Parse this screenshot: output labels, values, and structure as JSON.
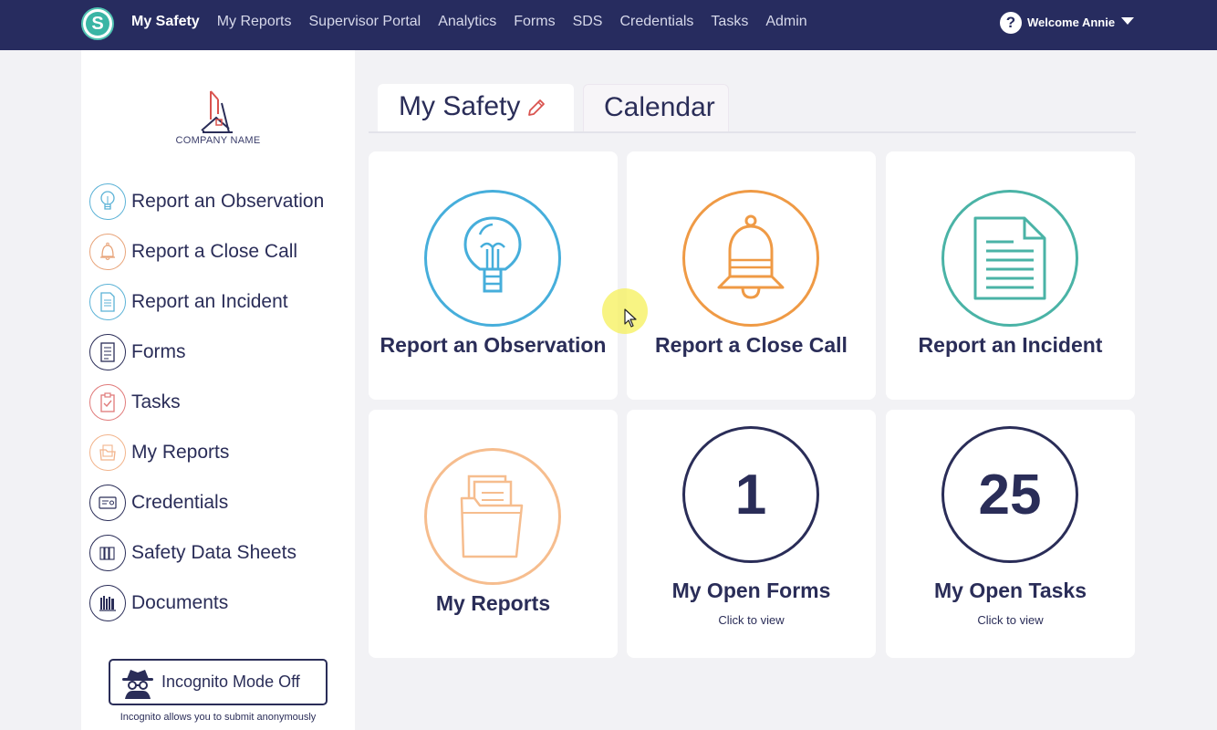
{
  "navbar": {
    "logo_letter": "S",
    "links": [
      {
        "label": "My Safety",
        "active": true
      },
      {
        "label": "My Reports"
      },
      {
        "label": "Supervisor Portal"
      },
      {
        "label": "Analytics"
      },
      {
        "label": "Forms"
      },
      {
        "label": "SDS"
      },
      {
        "label": "Credentials"
      },
      {
        "label": "Tasks"
      },
      {
        "label": "Admin"
      }
    ],
    "help_icon": "question-circle-icon",
    "welcome": "Welcome Annie",
    "colors": {
      "background": "#272c5f",
      "logo_teal": "#3ab5a5"
    }
  },
  "sidebar": {
    "company_name": "COMPANY NAME",
    "items": [
      {
        "label": "Report an Observation",
        "icon": "lightbulb-icon",
        "color": "#5bb2d6"
      },
      {
        "label": "Report a Close Call",
        "icon": "bell-icon",
        "color": "#e8a47a"
      },
      {
        "label": "Report an Incident",
        "icon": "document-icon",
        "color": "#5bb2d6"
      },
      {
        "label": "Forms",
        "icon": "form-icon",
        "color": "#2a2d58"
      },
      {
        "label": "Tasks",
        "icon": "clipboard-check-icon",
        "color": "#e07a7a"
      },
      {
        "label": "My Reports",
        "icon": "folder-icon",
        "color": "#f2b48c"
      },
      {
        "label": "Credentials",
        "icon": "id-card-icon",
        "color": "#2a2d58"
      },
      {
        "label": "Safety Data Sheets",
        "icon": "binders-icon",
        "color": "#2a2d58"
      },
      {
        "label": "Documents",
        "icon": "library-icon",
        "color": "#2a2d58"
      }
    ],
    "incognito": {
      "label": "Incognito Mode Off",
      "note": "Incognito allows you to submit anonymously",
      "icon": "spy-icon"
    }
  },
  "tabs": [
    {
      "label": "My Safety",
      "active": true,
      "edit_icon": "pencil-icon"
    },
    {
      "label": "Calendar",
      "active": false
    }
  ],
  "cards": [
    {
      "title": "Report an Observation",
      "icon": "lightbulb-icon",
      "color": "#46aedb"
    },
    {
      "title": "Report a Close Call",
      "icon": "bell-icon",
      "color": "#ef9a45"
    },
    {
      "title": "Report an Incident",
      "icon": "document-icon",
      "color": "#4ab3a6"
    },
    {
      "title": "My Reports",
      "icon": "folder-icon",
      "color": "#f6bd8e"
    },
    {
      "title": "My Open Forms",
      "count": "1",
      "subtitle": "Click to view",
      "color": "#2a2d58"
    },
    {
      "title": "My Open Tasks",
      "count": "25",
      "subtitle": "Click to view",
      "color": "#2a2d58"
    }
  ]
}
